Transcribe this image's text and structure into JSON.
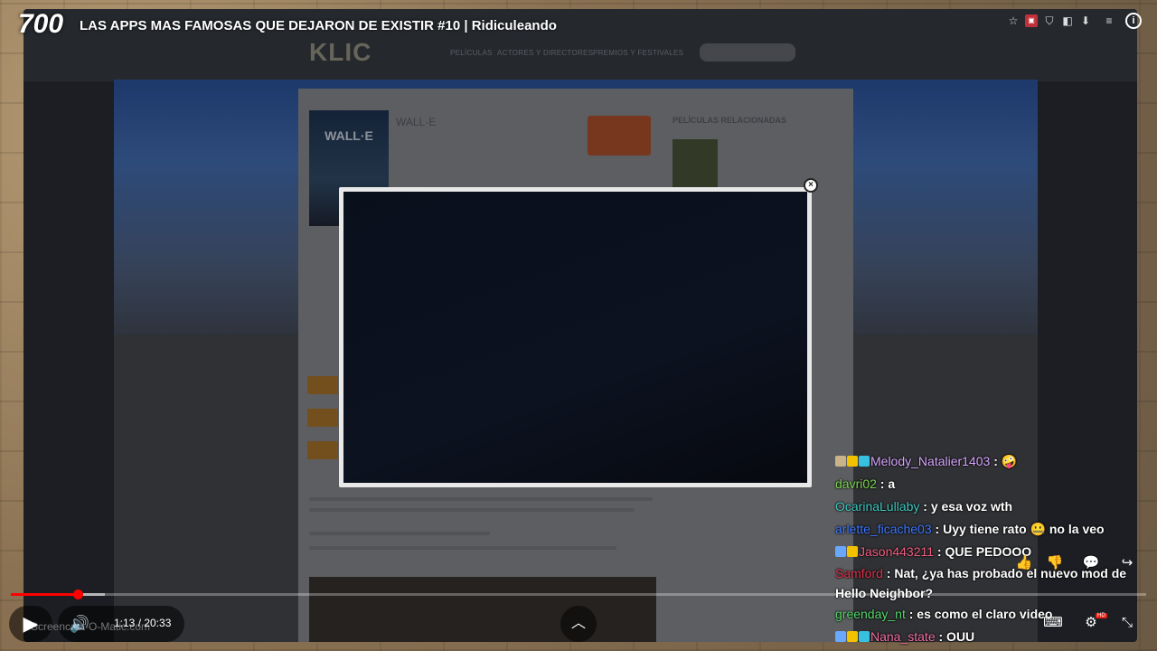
{
  "overlay": {
    "counter": "700",
    "video_title": "LAS APPS MAS FAMOSAS QUE DEJARON DE EXISTIR #10 | Ridiculeando"
  },
  "site": {
    "logo": "KLIC",
    "nav": [
      "PELÍCULAS",
      "ACTORES Y DIRECTORES",
      "PREMIOS Y FESTIVALES"
    ],
    "movie_title": "WALL·E",
    "poster_text": "WALL·E",
    "related_heading": "PELÍCULAS RELACIONADAS",
    "modal_close": "×"
  },
  "chat": [
    {
      "user": "Melody_Natalier1403",
      "color": "#d7a6ff",
      "message": " : 🤪",
      "badges": [
        "#c9b48a",
        "#f2c200",
        "#37c0e0"
      ]
    },
    {
      "user": "davri02",
      "color": "#7cd64f",
      "message": " : a",
      "badges": []
    },
    {
      "user": "OcarinaLullaby",
      "color": "#3fc8c0",
      "message": " : y esa voz wth",
      "badges": []
    },
    {
      "user": "arlette_ficache03",
      "color": "#3f79ff",
      "message": " : Uyy tiene rato 🤐 no la veo",
      "badges": []
    },
    {
      "user": "Jason443211",
      "color": "#f06080",
      "message": " : QUE PEDOOO",
      "badges": [
        "#6aa8ff",
        "#f2c200"
      ]
    },
    {
      "user": "Samford",
      "color": "#e0304a",
      "message": " : Nat, ¿ya has probado el nuevo mod de Hello Neighbor?",
      "badges": [],
      "wrap": true
    },
    {
      "user": "greenday_nt",
      "color": "#54d96a",
      "message": " : es como el claro video",
      "badges": []
    },
    {
      "user": "Nana_state",
      "color": "#f070a0",
      "message": " : OUU",
      "badges": [
        "#6aa8ff",
        "#f2c200",
        "#37c0e0"
      ]
    }
  ],
  "player": {
    "time": "1:13 / 20:33",
    "progress": 0.059,
    "buffered": 0.083,
    "watermark": "Screencast-O-Matic.com",
    "hd": "HD"
  },
  "icons": {
    "play": "▶",
    "volume": "🔊",
    "expand": "︿",
    "like": "👍",
    "dislike": "👎",
    "comment": "💬",
    "share": "↪",
    "subtitles": "⌨",
    "settings": "⚙",
    "exit_fullscreen": "⤡",
    "info": "i"
  }
}
